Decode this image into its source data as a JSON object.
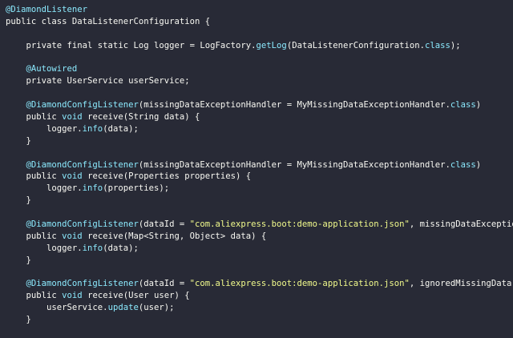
{
  "editor": {
    "lines": [
      [
        {
          "t": "@DiamondListener",
          "c": "ann"
        }
      ],
      [
        {
          "t": "public class ",
          "c": "kw"
        },
        {
          "t": "DataListenerConfiguration",
          "c": "cls"
        },
        {
          "t": " {",
          "c": "plain"
        }
      ],
      [],
      [
        {
          "t": "    private final static Log logger = LogFactory.",
          "c": "plain"
        },
        {
          "t": "getLog",
          "c": "fn"
        },
        {
          "t": "(DataListenerConfiguration.",
          "c": "plain"
        },
        {
          "t": "class",
          "c": "fn"
        },
        {
          "t": ");",
          "c": "plain"
        }
      ],
      [],
      [
        {
          "t": "    @Autowired",
          "c": "ann"
        }
      ],
      [
        {
          "t": "    private UserService userService;",
          "c": "plain"
        }
      ],
      [],
      [
        {
          "t": "    @DiamondConfigListener",
          "c": "ann"
        },
        {
          "t": "(missingDataExceptionHandler = MyMissingDataExceptionHandler.",
          "c": "plain"
        },
        {
          "t": "class",
          "c": "fn"
        },
        {
          "t": ")",
          "c": "plain"
        }
      ],
      [
        {
          "t": "    public ",
          "c": "kw"
        },
        {
          "t": "void ",
          "c": "fn"
        },
        {
          "t": "receive(String data) {",
          "c": "plain"
        }
      ],
      [
        {
          "t": "        logger.",
          "c": "plain"
        },
        {
          "t": "info",
          "c": "fn"
        },
        {
          "t": "(data);",
          "c": "plain"
        }
      ],
      [
        {
          "t": "    }",
          "c": "plain"
        }
      ],
      [],
      [
        {
          "t": "    @DiamondConfigListener",
          "c": "ann"
        },
        {
          "t": "(missingDataExceptionHandler = MyMissingDataExceptionHandler.",
          "c": "plain"
        },
        {
          "t": "class",
          "c": "fn"
        },
        {
          "t": ")",
          "c": "plain"
        }
      ],
      [
        {
          "t": "    public ",
          "c": "kw"
        },
        {
          "t": "void ",
          "c": "fn"
        },
        {
          "t": "receive(Properties properties) {",
          "c": "plain"
        }
      ],
      [
        {
          "t": "        logger.",
          "c": "plain"
        },
        {
          "t": "info",
          "c": "fn"
        },
        {
          "t": "(properties);",
          "c": "plain"
        }
      ],
      [
        {
          "t": "    }",
          "c": "plain"
        }
      ],
      [],
      [
        {
          "t": "    @DiamondConfigListener",
          "c": "ann"
        },
        {
          "t": "(dataId = ",
          "c": "plain"
        },
        {
          "t": "\"com.aliexpress.boot:demo-application.json\"",
          "c": "str"
        },
        {
          "t": ", missingDataExceptionHandler",
          "c": "plain"
        }
      ],
      [
        {
          "t": "    public ",
          "c": "kw"
        },
        {
          "t": "void ",
          "c": "fn"
        },
        {
          "t": "receive(Map<String, Object> data) {",
          "c": "plain"
        }
      ],
      [
        {
          "t": "        logger.",
          "c": "plain"
        },
        {
          "t": "info",
          "c": "fn"
        },
        {
          "t": "(data);",
          "c": "plain"
        }
      ],
      [
        {
          "t": "    }",
          "c": "plain"
        }
      ],
      [],
      [
        {
          "t": "    @DiamondConfigListener",
          "c": "ann"
        },
        {
          "t": "(dataId = ",
          "c": "plain"
        },
        {
          "t": "\"com.aliexpress.boot:demo-application.json\"",
          "c": "str"
        },
        {
          "t": ", ignoredMissingData = true, ",
          "c": "plain"
        }
      ],
      [
        {
          "t": "    public ",
          "c": "kw"
        },
        {
          "t": "void ",
          "c": "fn"
        },
        {
          "t": "receive(User user) {",
          "c": "plain"
        }
      ],
      [
        {
          "t": "        userService.",
          "c": "plain"
        },
        {
          "t": "update",
          "c": "fn"
        },
        {
          "t": "(user);",
          "c": "plain"
        }
      ],
      [
        {
          "t": "    }",
          "c": "plain"
        }
      ]
    ]
  },
  "colors": {
    "background": "#282a36",
    "text": "#f8f8f2",
    "annotation": "#8be9fd",
    "string": "#f1fa8c"
  }
}
